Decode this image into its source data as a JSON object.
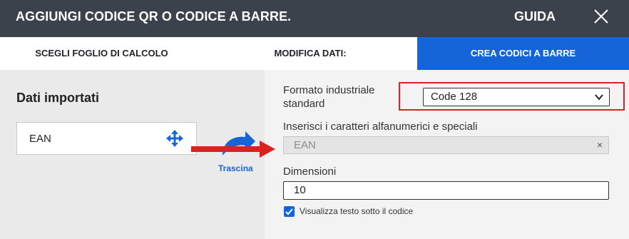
{
  "header": {
    "title": "AGGIUNGI CODICE QR O CODICE A BARRE.",
    "help_label": "GUIDA"
  },
  "tabs": [
    {
      "label": "SCEGLI FOGLIO DI CALCOLO",
      "active": false
    },
    {
      "label": "MODIFICA DATI:",
      "active": false
    },
    {
      "label": "CREA CODICI A BARRE",
      "active": true
    }
  ],
  "left_panel": {
    "title": "Dati importati",
    "field_card_label": "EAN",
    "drag_label": "Trascina"
  },
  "form": {
    "format": {
      "label_line1": "Formato industriale",
      "label_line2": "standard",
      "value": "Code 128"
    },
    "characters": {
      "label": "Inserisci i caratteri alfanumerici e speciali",
      "value": "EAN",
      "clear_label": "×"
    },
    "dimensions": {
      "label": "Dimensioni",
      "value": "10"
    },
    "show_text": {
      "label": "Visualizza testo sotto il codice",
      "checked": true
    }
  },
  "colors": {
    "header_bg": "#3b424c",
    "accent": "#1565d8",
    "highlight_red": "#e02020"
  }
}
